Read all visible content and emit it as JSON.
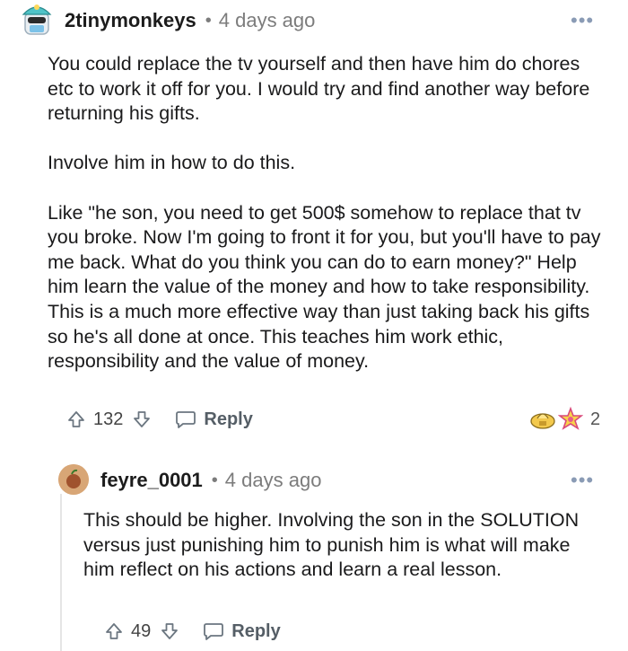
{
  "comments": [
    {
      "username": "2tinymonkeys",
      "separator": "•",
      "age": "4 days ago",
      "more": "•••",
      "paragraphs": [
        "You could replace the tv yourself and then have him do chores etc to work it off for you. I would try and find another way before returning his gifts.",
        "Involve him in how to do this.",
        "Like \"he son, you need to get 500$ somehow to replace that tv you broke. Now I'm going to front it for you, but you'll have to pay me back. What do you think you can do to earn money?\" Help him learn the value of the money and how to take responsibility. This is a much more effective way than just taking back his gifts so he's all done at once. This teaches him work ethic, responsibility and the value of money."
      ],
      "votes": "132",
      "reply_label": "Reply",
      "awards_count": "2"
    },
    {
      "username": "feyre_0001",
      "separator": "•",
      "age": "4 days ago",
      "more": "•••",
      "paragraphs": [
        "This should be higher. Involving the son in the SOLUTION versus just punishing him to punish him is what will make him reflect on his actions and learn a real lesson."
      ],
      "votes": "49",
      "reply_label": "Reply"
    }
  ],
  "colors": {
    "meta_gray": "#7c7c7c",
    "more_dots": "#8a9bb5",
    "text": "#1a1a1b"
  },
  "icons": [
    "avatar",
    "more-icon",
    "upvote-icon",
    "downvote-icon",
    "reply-bubble-icon",
    "award-icon"
  ]
}
